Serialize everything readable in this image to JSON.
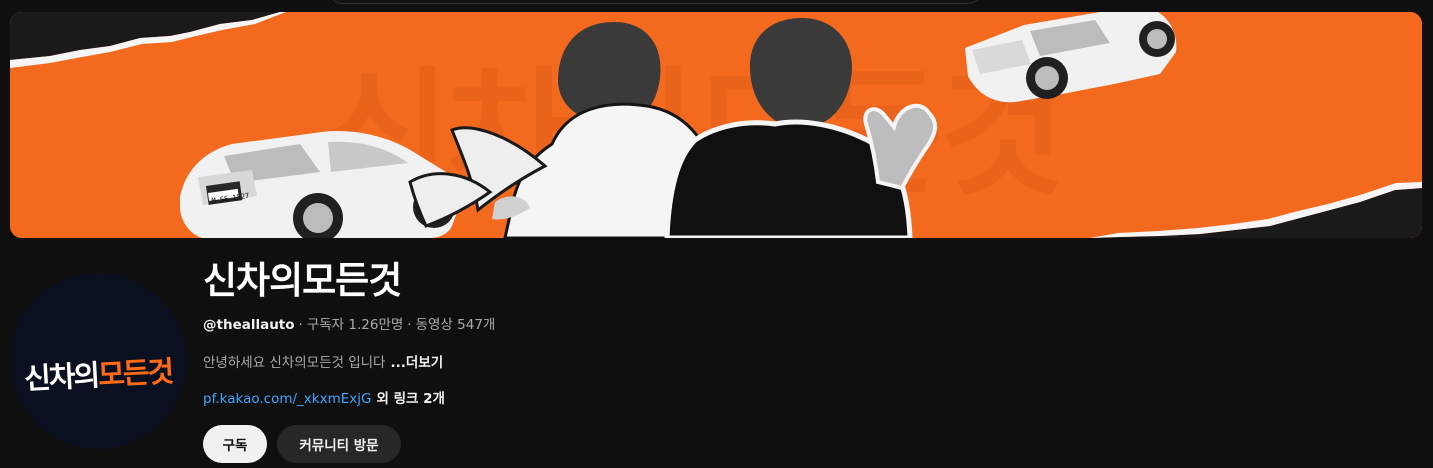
{
  "banner": {
    "background_text": "신차의모든것",
    "license_plate": "M-SE 1527",
    "colors": {
      "orange": "#f36a1f",
      "dark": "#121212",
      "paper": "#f2f2f2"
    }
  },
  "avatar": {
    "text_white": "신차의",
    "text_orange": "모든것",
    "background_color": "#0b1020"
  },
  "channel": {
    "title": "신차의모든것",
    "handle": "@theallauto",
    "separator": "·",
    "subscribers": "구독자 1.26만명",
    "videos": "동영상 547개",
    "description": "안녕하세요 신차의모든것 입니다",
    "more_label": "...더보기",
    "link_text": "pf.kakao.com/_xkxmExjG",
    "more_links_label": "외 링크 2개"
  },
  "buttons": {
    "subscribe": "구독",
    "community": "커뮤니티 방문"
  },
  "colors": {
    "page_background": "#0f0f0f",
    "primary_text": "#f1f1f1",
    "secondary_text": "#aaaaaa",
    "link": "#3ea6ff",
    "brand_orange": "#ff6a17"
  },
  "icons": {
    "search_bar_remnant": "search-bar-remnant"
  }
}
